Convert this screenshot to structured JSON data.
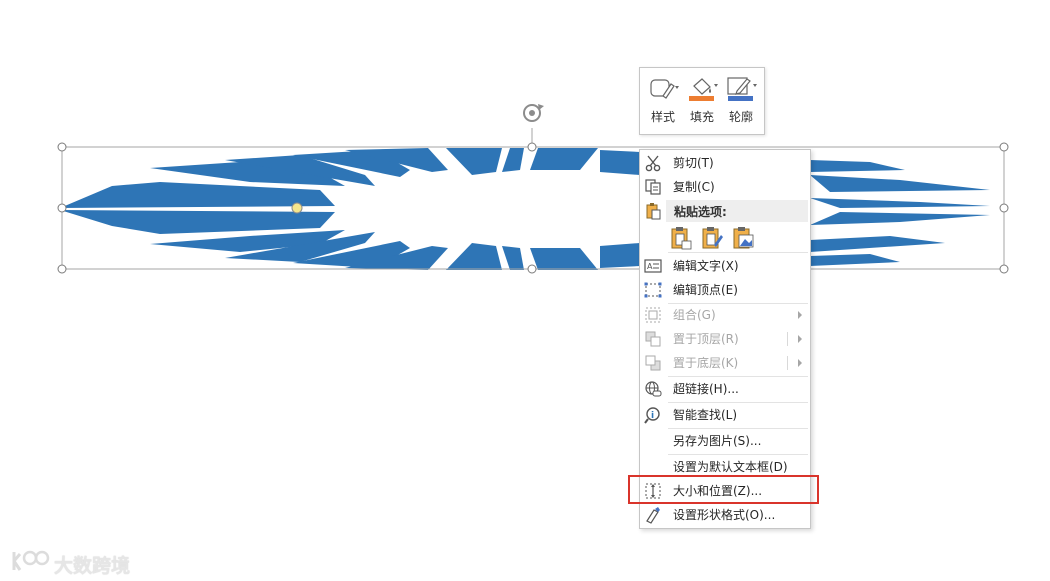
{
  "mini_toolbar": {
    "style_label": "样式",
    "fill_label": "填充",
    "outline_label": "轮廓",
    "fill_color": "#ED7D31",
    "outline_color": "#4472C4"
  },
  "shape": {
    "fill_color": "#2E75B6"
  },
  "context_menu": {
    "cut": "剪切(T)",
    "copy": "复制(C)",
    "paste_options": "粘贴选项:",
    "edit_text": "编辑文字(X)",
    "edit_points": "编辑顶点(E)",
    "group": "组合(G)",
    "bring_to_front": "置于顶层(R)",
    "send_to_back": "置于底层(K)",
    "hyperlink": "超链接(H)...",
    "smart_lookup": "智能查找(L)",
    "save_as_picture": "另存为图片(S)...",
    "set_default_textbox": "设置为默认文本框(D)",
    "size_and_position": "大小和位置(Z)...",
    "format_shape": "设置形状格式(O)..."
  },
  "highlight_color": "#D9342B",
  "watermark": {
    "text": "大数跨境"
  }
}
